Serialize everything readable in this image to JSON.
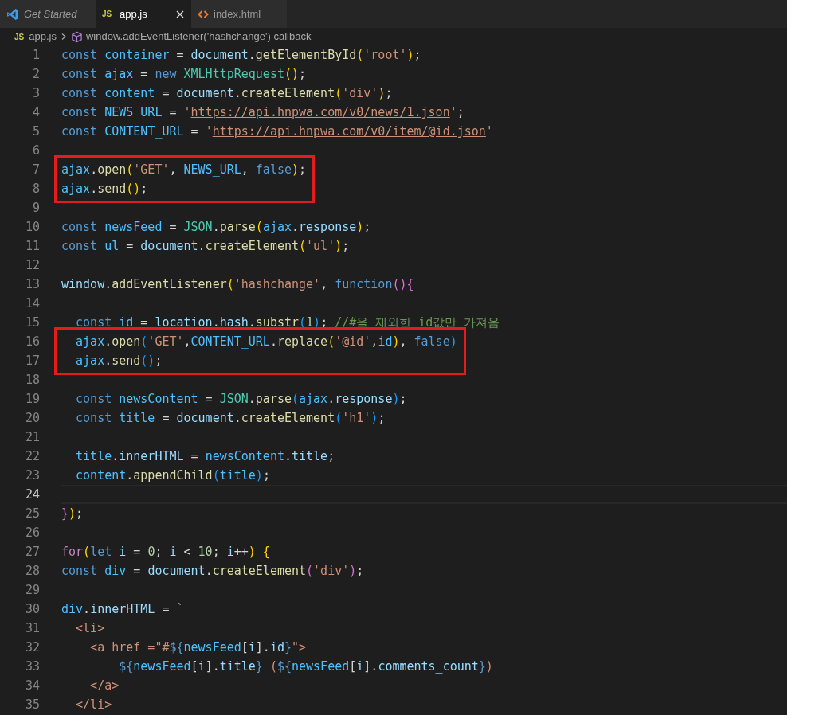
{
  "tabs": [
    {
      "kind": "welcome",
      "label": "Get Started",
      "selected": false
    },
    {
      "kind": "js",
      "badge": "JS",
      "label": "app.js",
      "selected": true
    },
    {
      "kind": "html",
      "label": "index.html",
      "selected": false
    }
  ],
  "breadcrumb": {
    "badge": "JS",
    "file": "app.js",
    "symbol": "window.addEventListener('hashchange') callback"
  },
  "lines": [
    {
      "number": "1",
      "boxed": false,
      "current": false,
      "tokens": [
        {
          "kind": "keyword",
          "text": "const "
        },
        {
          "kind": "const",
          "text": "container"
        },
        {
          "kind": "plain",
          "text": " = "
        },
        {
          "kind": "var",
          "text": "document"
        },
        {
          "kind": "plain",
          "text": "."
        },
        {
          "kind": "func",
          "text": "getElementById"
        },
        {
          "kind": "br1",
          "text": "("
        },
        {
          "kind": "str",
          "text": "'root'"
        },
        {
          "kind": "br1",
          "text": ")"
        },
        {
          "kind": "plain",
          "text": ";"
        }
      ]
    },
    {
      "number": "2",
      "boxed": false,
      "current": false,
      "tokens": [
        {
          "kind": "keyword",
          "text": "const "
        },
        {
          "kind": "const",
          "text": "ajax"
        },
        {
          "kind": "plain",
          "text": " = "
        },
        {
          "kind": "keyword",
          "text": "new "
        },
        {
          "kind": "type",
          "text": "XMLHttpRequest"
        },
        {
          "kind": "br1",
          "text": "()"
        },
        {
          "kind": "plain",
          "text": ";"
        }
      ]
    },
    {
      "number": "3",
      "boxed": false,
      "current": false,
      "tokens": [
        {
          "kind": "keyword",
          "text": "const "
        },
        {
          "kind": "const",
          "text": "content"
        },
        {
          "kind": "plain",
          "text": " = "
        },
        {
          "kind": "var",
          "text": "document"
        },
        {
          "kind": "plain",
          "text": "."
        },
        {
          "kind": "func",
          "text": "createElement"
        },
        {
          "kind": "br1",
          "text": "("
        },
        {
          "kind": "str",
          "text": "'div'"
        },
        {
          "kind": "br1",
          "text": ")"
        },
        {
          "kind": "plain",
          "text": ";"
        }
      ]
    },
    {
      "number": "4",
      "boxed": false,
      "current": false,
      "tokens": [
        {
          "kind": "keyword",
          "text": "const "
        },
        {
          "kind": "const",
          "text": "NEWS_URL"
        },
        {
          "kind": "plain",
          "text": " = "
        },
        {
          "kind": "str",
          "text": "'"
        },
        {
          "kind": "url",
          "text": "https://api.hnpwa.com/v0/news/1.json"
        },
        {
          "kind": "str",
          "text": "'"
        },
        {
          "kind": "plain",
          "text": ";"
        }
      ]
    },
    {
      "number": "5",
      "boxed": false,
      "current": false,
      "tokens": [
        {
          "kind": "keyword",
          "text": "const "
        },
        {
          "kind": "const",
          "text": "CONTENT_URL"
        },
        {
          "kind": "plain",
          "text": " = "
        },
        {
          "kind": "str",
          "text": "'"
        },
        {
          "kind": "url",
          "text": "https://api.hnpwa.com/v0/item/@id.json"
        },
        {
          "kind": "str",
          "text": "'"
        }
      ]
    },
    {
      "number": "6",
      "boxed": false,
      "current": false
    },
    {
      "number": "7",
      "boxed": true,
      "current": false,
      "tokens": [
        {
          "kind": "const",
          "text": "ajax"
        },
        {
          "kind": "plain",
          "text": "."
        },
        {
          "kind": "func",
          "text": "open"
        },
        {
          "kind": "br1",
          "text": "("
        },
        {
          "kind": "str",
          "text": "'GET'"
        },
        {
          "kind": "plain",
          "text": ", "
        },
        {
          "kind": "const",
          "text": "NEWS_URL"
        },
        {
          "kind": "plain",
          "text": ", "
        },
        {
          "kind": "keyword",
          "text": "false"
        },
        {
          "kind": "br1",
          "text": ")"
        },
        {
          "kind": "plain",
          "text": ";"
        }
      ]
    },
    {
      "number": "8",
      "boxed": true,
      "current": false,
      "tokens": [
        {
          "kind": "const",
          "text": "ajax"
        },
        {
          "kind": "plain",
          "text": "."
        },
        {
          "kind": "func",
          "text": "send"
        },
        {
          "kind": "br1",
          "text": "()"
        },
        {
          "kind": "plain",
          "text": ";"
        }
      ]
    },
    {
      "number": "9",
      "boxed": false,
      "current": false
    },
    {
      "number": "10",
      "boxed": false,
      "current": false,
      "tokens": [
        {
          "kind": "keyword",
          "text": "const "
        },
        {
          "kind": "const",
          "text": "newsFeed"
        },
        {
          "kind": "plain",
          "text": " = "
        },
        {
          "kind": "type",
          "text": "JSON"
        },
        {
          "kind": "plain",
          "text": "."
        },
        {
          "kind": "func",
          "text": "parse"
        },
        {
          "kind": "br1",
          "text": "("
        },
        {
          "kind": "const",
          "text": "ajax"
        },
        {
          "kind": "plain",
          "text": "."
        },
        {
          "kind": "var",
          "text": "response"
        },
        {
          "kind": "br1",
          "text": ")"
        },
        {
          "kind": "plain",
          "text": ";"
        }
      ]
    },
    {
      "number": "11",
      "boxed": false,
      "current": false,
      "tokens": [
        {
          "kind": "keyword",
          "text": "const "
        },
        {
          "kind": "const",
          "text": "ul"
        },
        {
          "kind": "plain",
          "text": " = "
        },
        {
          "kind": "var",
          "text": "document"
        },
        {
          "kind": "plain",
          "text": "."
        },
        {
          "kind": "func",
          "text": "createElement"
        },
        {
          "kind": "br1",
          "text": "("
        },
        {
          "kind": "str",
          "text": "'ul'"
        },
        {
          "kind": "br1",
          "text": ")"
        },
        {
          "kind": "plain",
          "text": ";"
        }
      ]
    },
    {
      "number": "12",
      "boxed": false,
      "current": false
    },
    {
      "number": "13",
      "boxed": false,
      "current": false,
      "tokens": [
        {
          "kind": "var",
          "text": "window"
        },
        {
          "kind": "plain",
          "text": "."
        },
        {
          "kind": "func",
          "text": "addEventListener"
        },
        {
          "kind": "br1",
          "text": "("
        },
        {
          "kind": "str",
          "text": "'hashchange'"
        },
        {
          "kind": "plain",
          "text": ", "
        },
        {
          "kind": "keyword",
          "text": "function"
        },
        {
          "kind": "br2",
          "text": "(){"
        }
      ]
    },
    {
      "number": "14",
      "boxed": false,
      "current": false
    },
    {
      "number": "15",
      "boxed": false,
      "current": false,
      "tokens": [
        {
          "kind": "keyword",
          "text": "  const "
        },
        {
          "kind": "const",
          "text": "id"
        },
        {
          "kind": "plain",
          "text": " = "
        },
        {
          "kind": "var",
          "text": "location"
        },
        {
          "kind": "plain",
          "text": "."
        },
        {
          "kind": "var",
          "text": "hash"
        },
        {
          "kind": "plain",
          "text": "."
        },
        {
          "kind": "func",
          "text": "substr"
        },
        {
          "kind": "br3",
          "text": "("
        },
        {
          "kind": "num",
          "text": "1"
        },
        {
          "kind": "br3",
          "text": ")"
        },
        {
          "kind": "plain",
          "text": "; "
        },
        {
          "kind": "comment",
          "text": "//#을 제외한 id값만 가져옴"
        }
      ]
    },
    {
      "number": "16",
      "boxed": true,
      "current": false,
      "tokens": [
        {
          "kind": "const",
          "text": "  ajax"
        },
        {
          "kind": "plain",
          "text": "."
        },
        {
          "kind": "func",
          "text": "open"
        },
        {
          "kind": "br3",
          "text": "("
        },
        {
          "kind": "str",
          "text": "'GET'"
        },
        {
          "kind": "plain",
          "text": ","
        },
        {
          "kind": "const",
          "text": "CONTENT_URL"
        },
        {
          "kind": "plain",
          "text": "."
        },
        {
          "kind": "func",
          "text": "replace"
        },
        {
          "kind": "br1",
          "text": "("
        },
        {
          "kind": "str",
          "text": "'@id'"
        },
        {
          "kind": "plain",
          "text": ","
        },
        {
          "kind": "const",
          "text": "id"
        },
        {
          "kind": "br1",
          "text": ")"
        },
        {
          "kind": "plain",
          "text": ", "
        },
        {
          "kind": "keyword",
          "text": "false"
        },
        {
          "kind": "br3",
          "text": ")"
        }
      ]
    },
    {
      "number": "17",
      "boxed": true,
      "current": false,
      "tokens": [
        {
          "kind": "const",
          "text": "  ajax"
        },
        {
          "kind": "plain",
          "text": "."
        },
        {
          "kind": "func",
          "text": "send"
        },
        {
          "kind": "br3",
          "text": "()"
        },
        {
          "kind": "plain",
          "text": ";"
        }
      ]
    },
    {
      "number": "18",
      "boxed": false,
      "current": false
    },
    {
      "number": "19",
      "boxed": false,
      "current": false,
      "tokens": [
        {
          "kind": "keyword",
          "text": "  const "
        },
        {
          "kind": "const",
          "text": "newsContent"
        },
        {
          "kind": "plain",
          "text": " = "
        },
        {
          "kind": "type",
          "text": "JSON"
        },
        {
          "kind": "plain",
          "text": "."
        },
        {
          "kind": "func",
          "text": "parse"
        },
        {
          "kind": "br3",
          "text": "("
        },
        {
          "kind": "const",
          "text": "ajax"
        },
        {
          "kind": "plain",
          "text": "."
        },
        {
          "kind": "var",
          "text": "response"
        },
        {
          "kind": "br3",
          "text": ")"
        },
        {
          "kind": "plain",
          "text": ";"
        }
      ]
    },
    {
      "number": "20",
      "boxed": false,
      "current": false,
      "tokens": [
        {
          "kind": "keyword",
          "text": "  const "
        },
        {
          "kind": "const",
          "text": "title"
        },
        {
          "kind": "plain",
          "text": " = "
        },
        {
          "kind": "var",
          "text": "document"
        },
        {
          "kind": "plain",
          "text": "."
        },
        {
          "kind": "func",
          "text": "createElement"
        },
        {
          "kind": "br3",
          "text": "("
        },
        {
          "kind": "str",
          "text": "'h1'"
        },
        {
          "kind": "br3",
          "text": ")"
        },
        {
          "kind": "plain",
          "text": ";"
        }
      ]
    },
    {
      "number": "21",
      "boxed": false,
      "current": false
    },
    {
      "number": "22",
      "boxed": false,
      "current": false,
      "tokens": [
        {
          "kind": "const",
          "text": "  title"
        },
        {
          "kind": "plain",
          "text": "."
        },
        {
          "kind": "var",
          "text": "innerHTML"
        },
        {
          "kind": "plain",
          "text": " = "
        },
        {
          "kind": "const",
          "text": "newsContent"
        },
        {
          "kind": "plain",
          "text": "."
        },
        {
          "kind": "var",
          "text": "title"
        },
        {
          "kind": "plain",
          "text": ";"
        }
      ]
    },
    {
      "number": "23",
      "boxed": false,
      "current": false,
      "tokens": [
        {
          "kind": "const",
          "text": "  content"
        },
        {
          "kind": "plain",
          "text": "."
        },
        {
          "kind": "func",
          "text": "appendChild"
        },
        {
          "kind": "br3",
          "text": "("
        },
        {
          "kind": "const",
          "text": "title"
        },
        {
          "kind": "br3",
          "text": ")"
        },
        {
          "kind": "plain",
          "text": ";"
        }
      ]
    },
    {
      "number": "24",
      "boxed": false,
      "current": true
    },
    {
      "number": "25",
      "boxed": false,
      "current": false,
      "tokens": [
        {
          "kind": "br2",
          "text": "}"
        },
        {
          "kind": "br1",
          "text": ")"
        },
        {
          "kind": "plain",
          "text": ";"
        }
      ]
    },
    {
      "number": "26",
      "boxed": false,
      "current": false
    },
    {
      "number": "27",
      "boxed": false,
      "current": false,
      "tokens": [
        {
          "kind": "control",
          "text": "for"
        },
        {
          "kind": "br1",
          "text": "("
        },
        {
          "kind": "keyword",
          "text": "let "
        },
        {
          "kind": "var",
          "text": "i"
        },
        {
          "kind": "plain",
          "text": " = "
        },
        {
          "kind": "num",
          "text": "0"
        },
        {
          "kind": "plain",
          "text": "; "
        },
        {
          "kind": "var",
          "text": "i"
        },
        {
          "kind": "plain",
          "text": " < "
        },
        {
          "kind": "num",
          "text": "10"
        },
        {
          "kind": "plain",
          "text": "; "
        },
        {
          "kind": "var",
          "text": "i"
        },
        {
          "kind": "plain",
          "text": "++"
        },
        {
          "kind": "br1",
          "text": ") {"
        }
      ]
    },
    {
      "number": "28",
      "boxed": false,
      "current": false,
      "tokens": [
        {
          "kind": "keyword",
          "text": "const "
        },
        {
          "kind": "const",
          "text": "div"
        },
        {
          "kind": "plain",
          "text": " = "
        },
        {
          "kind": "var",
          "text": "document"
        },
        {
          "kind": "plain",
          "text": "."
        },
        {
          "kind": "func",
          "text": "createElement"
        },
        {
          "kind": "br2",
          "text": "("
        },
        {
          "kind": "str",
          "text": "'div'"
        },
        {
          "kind": "br2",
          "text": ")"
        },
        {
          "kind": "plain",
          "text": ";"
        }
      ]
    },
    {
      "number": "29",
      "boxed": false,
      "current": false
    },
    {
      "number": "30",
      "boxed": false,
      "current": false,
      "tokens": [
        {
          "kind": "const",
          "text": "div"
        },
        {
          "kind": "plain",
          "text": "."
        },
        {
          "kind": "var",
          "text": "innerHTML"
        },
        {
          "kind": "plain",
          "text": " = "
        },
        {
          "kind": "str",
          "text": "`"
        }
      ]
    },
    {
      "number": "31",
      "boxed": false,
      "current": false,
      "tokens": [
        {
          "kind": "str",
          "text": "  <li>"
        }
      ]
    },
    {
      "number": "32",
      "boxed": false,
      "current": false,
      "tokens": [
        {
          "kind": "str",
          "text": "    <a href =\"#"
        },
        {
          "kind": "keyword",
          "text": "${"
        },
        {
          "kind": "const",
          "text": "newsFeed"
        },
        {
          "kind": "plain",
          "text": "["
        },
        {
          "kind": "var",
          "text": "i"
        },
        {
          "kind": "plain",
          "text": "]."
        },
        {
          "kind": "var",
          "text": "id"
        },
        {
          "kind": "keyword",
          "text": "}"
        },
        {
          "kind": "str",
          "text": "\">"
        }
      ]
    },
    {
      "number": "33",
      "boxed": false,
      "current": false,
      "tokens": [
        {
          "kind": "keyword",
          "text": "        ${"
        },
        {
          "kind": "const",
          "text": "newsFeed"
        },
        {
          "kind": "plain",
          "text": "["
        },
        {
          "kind": "var",
          "text": "i"
        },
        {
          "kind": "plain",
          "text": "]."
        },
        {
          "kind": "var",
          "text": "title"
        },
        {
          "kind": "keyword",
          "text": "}"
        },
        {
          "kind": "str",
          "text": " ("
        },
        {
          "kind": "keyword",
          "text": "${"
        },
        {
          "kind": "const",
          "text": "newsFeed"
        },
        {
          "kind": "plain",
          "text": "["
        },
        {
          "kind": "var",
          "text": "i"
        },
        {
          "kind": "plain",
          "text": "]."
        },
        {
          "kind": "var",
          "text": "comments_count"
        },
        {
          "kind": "keyword",
          "text": "}"
        },
        {
          "kind": "str",
          "text": ")"
        }
      ]
    },
    {
      "number": "34",
      "boxed": false,
      "current": false,
      "tokens": [
        {
          "kind": "str",
          "text": "    </a>"
        }
      ]
    },
    {
      "number": "35",
      "boxed": false,
      "current": false,
      "tokens": [
        {
          "kind": "str",
          "text": "  </li>"
        }
      ]
    }
  ]
}
